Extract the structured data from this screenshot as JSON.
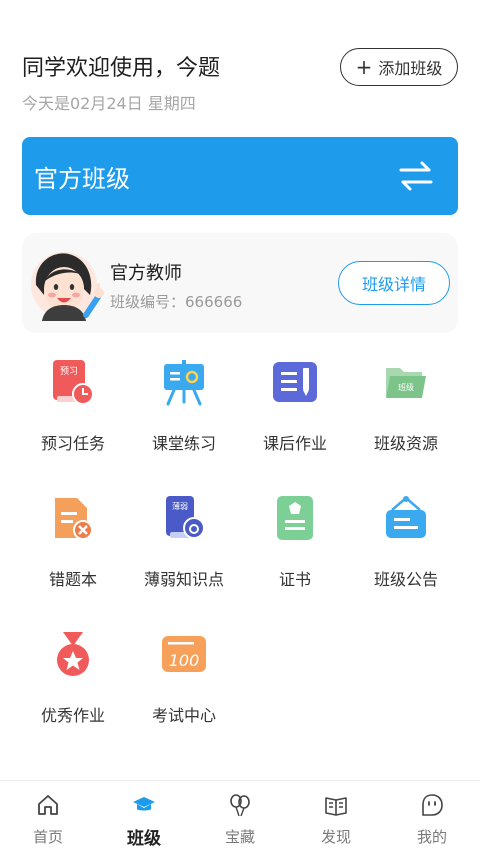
{
  "header": {
    "greeting": "同学欢迎使用，今题",
    "date": "今天是02月24日 星期四",
    "add_class_label": "添加班级"
  },
  "banner": {
    "title": "官方班级",
    "icon": "swap-arrows-icon"
  },
  "teacher": {
    "name": "官方教师",
    "class_no_label": "班级编号：",
    "class_no": "666666",
    "detail_label": "班级详情"
  },
  "features": [
    {
      "label": "预习任务",
      "icon": "preview-task-icon",
      "badge": "预习"
    },
    {
      "label": "课堂练习",
      "icon": "classroom-practice-icon"
    },
    {
      "label": "课后作业",
      "icon": "homework-icon"
    },
    {
      "label": "班级资源",
      "icon": "class-resources-icon",
      "badge": "班级"
    },
    {
      "label": "错题本",
      "icon": "wrong-questions-icon"
    },
    {
      "label": "薄弱知识点",
      "icon": "weak-points-icon",
      "badge": "薄弱"
    },
    {
      "label": "证书",
      "icon": "certificate-icon"
    },
    {
      "label": "班级公告",
      "icon": "class-notice-icon"
    },
    {
      "label": "优秀作业",
      "icon": "excellent-homework-icon"
    },
    {
      "label": "考试中心",
      "icon": "exam-center-icon",
      "badge": "100"
    }
  ],
  "tabs": [
    {
      "label": "首页",
      "icon": "home-icon"
    },
    {
      "label": "班级",
      "icon": "graduation-cap-icon",
      "active": true
    },
    {
      "label": "宝藏",
      "icon": "balloons-icon"
    },
    {
      "label": "发现",
      "icon": "book-icon"
    },
    {
      "label": "我的",
      "icon": "profile-face-icon"
    }
  ],
  "colors": {
    "accent": "#1e9bea",
    "text": "#222222",
    "muted": "#a6a6a6"
  }
}
